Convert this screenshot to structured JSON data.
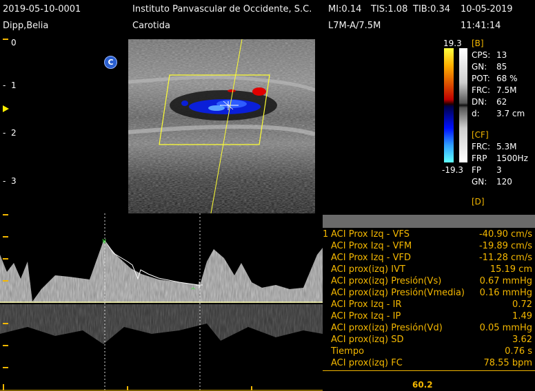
{
  "header": {
    "study_id": "2019-05-10-0001",
    "institution": "Instituto Panvascular de Occidente, S.C.",
    "mi": "MI:0.14",
    "tis": "TIS:1.08",
    "tib": "TIB:0.34",
    "date": "10-05-2019",
    "patient": "Dipp,Belia",
    "exam": "Carotida",
    "probe": "L7M-A/7.5M",
    "time": "11:41:14"
  },
  "depth_scale": [
    "0",
    "1",
    "2",
    "3"
  ],
  "orientation_marker": "C",
  "color_bar": {
    "top": "19.3",
    "bottom": "-19.3"
  },
  "settings": {
    "b_mode": {
      "title": "[B]",
      "rows": [
        {
          "k": "CPS:",
          "v": "13"
        },
        {
          "k": "GN:",
          "v": "85"
        },
        {
          "k": "POT:",
          "v": "68 %"
        },
        {
          "k": "FRC:",
          "v": "7.5M"
        },
        {
          "k": "DN:",
          "v": "62"
        },
        {
          "k": "d:",
          "v": "3.7 cm"
        }
      ]
    },
    "cf_mode": {
      "title": "[CF]",
      "rows": [
        {
          "k": "FRC:",
          "v": "5.3M"
        },
        {
          "k": "FRP",
          "v": "1500Hz"
        },
        {
          "k": "FP",
          "v": "3"
        },
        {
          "k": "GN:",
          "v": "120"
        }
      ]
    },
    "d_mode": {
      "title": "[D]"
    }
  },
  "measurements": {
    "index": "1",
    "rows": [
      {
        "label": "ACI Prox Izq - VFS",
        "value": "-40.90 cm/s"
      },
      {
        "label": "ACI Prox Izq - VFM",
        "value": "-19.89 cm/s"
      },
      {
        "label": "ACI Prox Izq - VFD",
        "value": "-11.28 cm/s"
      },
      {
        "label": "ACI prox(izq) IVT",
        "value": "15.19 cm"
      },
      {
        "label": "ACI prox(izq) Presión(Vs)",
        "value": "0.67 mmHg"
      },
      {
        "label": "ACI prox(izq) Presión(Vmedia)",
        "value": "0.16 mmHg"
      },
      {
        "label": "ACI Prox Izq - IR",
        "value": "0.72"
      },
      {
        "label": "ACI Prox Izq - IP",
        "value": "1.49"
      },
      {
        "label": "ACI prox(izq) Presión(Vd)",
        "value": "0.05 mmHg"
      },
      {
        "label": "ACI prox(izq) SD",
        "value": "3.62"
      },
      {
        "label": "Tiempo",
        "value": "0.76 s"
      },
      {
        "label": "ACI prox(izq) FC",
        "value": "78.55 bpm"
      }
    ]
  },
  "doppler_readout": "60.2",
  "colors": {
    "accent": "#f5b800",
    "cursor": "#ffff33"
  }
}
